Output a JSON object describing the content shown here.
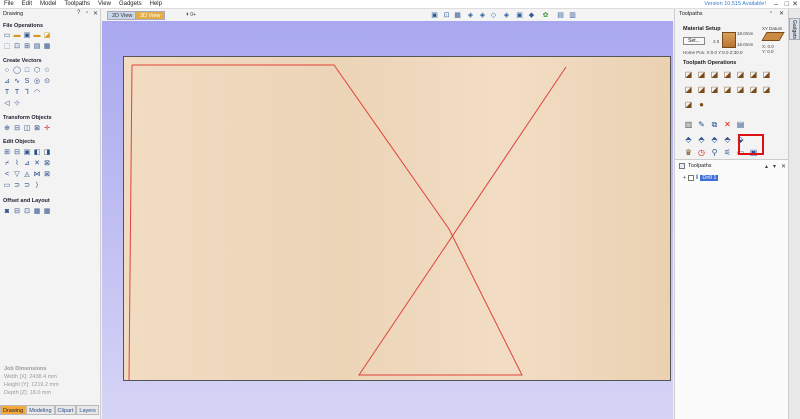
{
  "menubar": {
    "items": [
      "File",
      "Edit",
      "Model",
      "Toolpaths",
      "View",
      "Gadgets",
      "Help"
    ],
    "version": "Version 10.515 Available!"
  },
  "left_panel": {
    "title": "Drawing",
    "sections": [
      {
        "title": "File Operations",
        "rows": [
          [
            "new-file-icon",
            "open-file-icon",
            "save-icon",
            "import-icon",
            "import-bitmap-icon"
          ],
          [
            "fit-icon",
            "crop-icon",
            "measure-icon",
            "dimension-icon",
            "trace-icon"
          ]
        ]
      },
      {
        "title": "Create Vectors",
        "rows": [
          [
            "circle-icon",
            "ellipse-icon",
            "rectangle-icon",
            "polygon-icon",
            "star-icon"
          ],
          [
            "polyline-icon",
            "curve-icon",
            "arc-icon",
            "draw-icon",
            "offset-vector-icon"
          ],
          [
            "text-icon",
            "text-on-curve-icon",
            "bend-text-icon",
            "fillet-icon"
          ],
          [
            "dimension-vector-icon",
            "node-edit-icon"
          ]
        ]
      },
      {
        "title": "Transform Objects",
        "rows": [
          [
            "move-icon",
            "scale-icon",
            "rotate-icon",
            "mirror-icon",
            "align-icon"
          ]
        ]
      },
      {
        "title": "Edit Objects",
        "rows": [
          [
            "group-icon",
            "ungroup-icon",
            "weld-icon",
            "subtract-icon",
            "intersect-icon"
          ],
          [
            "trim-icon",
            "extend-icon",
            "join-icon",
            "close-vector-icon",
            "fillet-tool-icon"
          ],
          [
            "smooth-icon",
            "curve-fit-icon",
            "interpolate-icon",
            "break-icon",
            "delete-icon"
          ],
          [
            "node-icon",
            "dogbone-icon",
            "tab-icon",
            "bevel-icon",
            "chamfer-icon"
          ]
        ]
      },
      {
        "title": "Offset and Layout",
        "rows": [
          [
            "offset-icon",
            "nest-icon",
            "array-icon",
            "step-repeat-icon",
            "grid-icon"
          ]
        ]
      }
    ],
    "job_dimensions": {
      "title": "Job Dimensions",
      "width": "Width  [X]: 2438.4 mm",
      "height": "Height [Y]: 1219.2 mm",
      "depth": "Depth  [Z]: 18.0 mm"
    },
    "tabs": [
      "Drawing",
      "Modeling",
      "Clipart",
      "Layers"
    ]
  },
  "view": {
    "tab_2d": "2D View",
    "tab_3d": "3D View",
    "layer_label": "0+"
  },
  "right_panel": {
    "title": "Toolpaths",
    "material_setup": "Material Setup",
    "set_button": "Set...",
    "thickness": "18.0mm",
    "offset": "2.0",
    "gap": "16.0mm",
    "home_pos": "Home Pos:  X:0.0 Y:0.0 Z:30.0",
    "xy_datum": "XY Datum",
    "datum_x": "X: 0.0",
    "datum_y": "Y: 0.0",
    "toolpath_operations": "Toolpath Operations",
    "toolpaths_header": "Toolpaths",
    "toolpath_items": [
      {
        "name": "Drill 1",
        "selected": true
      }
    ]
  },
  "gadgets_tab": "Gadgets",
  "colors": {
    "board": "#ecd4b7",
    "toolpath_line": "#e0433a",
    "highlight": "#d11111",
    "viewport": "#b6b4f0"
  }
}
